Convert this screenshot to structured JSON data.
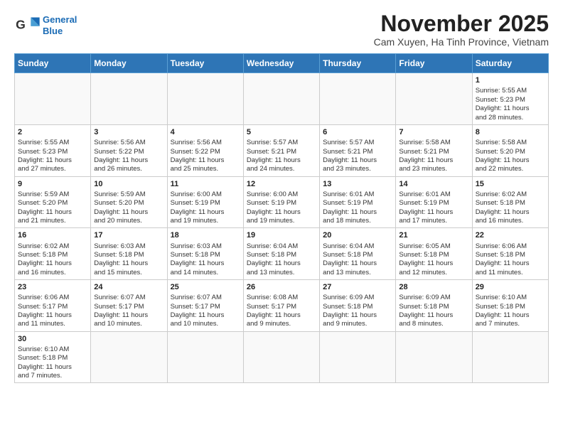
{
  "header": {
    "logo_line1": "General",
    "logo_line2": "Blue",
    "month": "November 2025",
    "location": "Cam Xuyen, Ha Tinh Province, Vietnam"
  },
  "weekdays": [
    "Sunday",
    "Monday",
    "Tuesday",
    "Wednesday",
    "Thursday",
    "Friday",
    "Saturday"
  ],
  "weeks": [
    [
      {
        "day": "",
        "info": ""
      },
      {
        "day": "",
        "info": ""
      },
      {
        "day": "",
        "info": ""
      },
      {
        "day": "",
        "info": ""
      },
      {
        "day": "",
        "info": ""
      },
      {
        "day": "",
        "info": ""
      },
      {
        "day": "1",
        "info": "Sunrise: 5:55 AM\nSunset: 5:23 PM\nDaylight: 11 hours\nand 28 minutes."
      }
    ],
    [
      {
        "day": "2",
        "info": "Sunrise: 5:55 AM\nSunset: 5:23 PM\nDaylight: 11 hours\nand 27 minutes."
      },
      {
        "day": "3",
        "info": "Sunrise: 5:56 AM\nSunset: 5:22 PM\nDaylight: 11 hours\nand 26 minutes."
      },
      {
        "day": "4",
        "info": "Sunrise: 5:56 AM\nSunset: 5:22 PM\nDaylight: 11 hours\nand 25 minutes."
      },
      {
        "day": "5",
        "info": "Sunrise: 5:57 AM\nSunset: 5:21 PM\nDaylight: 11 hours\nand 24 minutes."
      },
      {
        "day": "6",
        "info": "Sunrise: 5:57 AM\nSunset: 5:21 PM\nDaylight: 11 hours\nand 23 minutes."
      },
      {
        "day": "7",
        "info": "Sunrise: 5:58 AM\nSunset: 5:21 PM\nDaylight: 11 hours\nand 23 minutes."
      },
      {
        "day": "8",
        "info": "Sunrise: 5:58 AM\nSunset: 5:20 PM\nDaylight: 11 hours\nand 22 minutes."
      }
    ],
    [
      {
        "day": "9",
        "info": "Sunrise: 5:59 AM\nSunset: 5:20 PM\nDaylight: 11 hours\nand 21 minutes."
      },
      {
        "day": "10",
        "info": "Sunrise: 5:59 AM\nSunset: 5:20 PM\nDaylight: 11 hours\nand 20 minutes."
      },
      {
        "day": "11",
        "info": "Sunrise: 6:00 AM\nSunset: 5:19 PM\nDaylight: 11 hours\nand 19 minutes."
      },
      {
        "day": "12",
        "info": "Sunrise: 6:00 AM\nSunset: 5:19 PM\nDaylight: 11 hours\nand 19 minutes."
      },
      {
        "day": "13",
        "info": "Sunrise: 6:01 AM\nSunset: 5:19 PM\nDaylight: 11 hours\nand 18 minutes."
      },
      {
        "day": "14",
        "info": "Sunrise: 6:01 AM\nSunset: 5:19 PM\nDaylight: 11 hours\nand 17 minutes."
      },
      {
        "day": "15",
        "info": "Sunrise: 6:02 AM\nSunset: 5:18 PM\nDaylight: 11 hours\nand 16 minutes."
      }
    ],
    [
      {
        "day": "16",
        "info": "Sunrise: 6:02 AM\nSunset: 5:18 PM\nDaylight: 11 hours\nand 16 minutes."
      },
      {
        "day": "17",
        "info": "Sunrise: 6:03 AM\nSunset: 5:18 PM\nDaylight: 11 hours\nand 15 minutes."
      },
      {
        "day": "18",
        "info": "Sunrise: 6:03 AM\nSunset: 5:18 PM\nDaylight: 11 hours\nand 14 minutes."
      },
      {
        "day": "19",
        "info": "Sunrise: 6:04 AM\nSunset: 5:18 PM\nDaylight: 11 hours\nand 13 minutes."
      },
      {
        "day": "20",
        "info": "Sunrise: 6:04 AM\nSunset: 5:18 PM\nDaylight: 11 hours\nand 13 minutes."
      },
      {
        "day": "21",
        "info": "Sunrise: 6:05 AM\nSunset: 5:18 PM\nDaylight: 11 hours\nand 12 minutes."
      },
      {
        "day": "22",
        "info": "Sunrise: 6:06 AM\nSunset: 5:18 PM\nDaylight: 11 hours\nand 11 minutes."
      }
    ],
    [
      {
        "day": "23",
        "info": "Sunrise: 6:06 AM\nSunset: 5:17 PM\nDaylight: 11 hours\nand 11 minutes."
      },
      {
        "day": "24",
        "info": "Sunrise: 6:07 AM\nSunset: 5:17 PM\nDaylight: 11 hours\nand 10 minutes."
      },
      {
        "day": "25",
        "info": "Sunrise: 6:07 AM\nSunset: 5:17 PM\nDaylight: 11 hours\nand 10 minutes."
      },
      {
        "day": "26",
        "info": "Sunrise: 6:08 AM\nSunset: 5:17 PM\nDaylight: 11 hours\nand 9 minutes."
      },
      {
        "day": "27",
        "info": "Sunrise: 6:09 AM\nSunset: 5:18 PM\nDaylight: 11 hours\nand 9 minutes."
      },
      {
        "day": "28",
        "info": "Sunrise: 6:09 AM\nSunset: 5:18 PM\nDaylight: 11 hours\nand 8 minutes."
      },
      {
        "day": "29",
        "info": "Sunrise: 6:10 AM\nSunset: 5:18 PM\nDaylight: 11 hours\nand 7 minutes."
      }
    ],
    [
      {
        "day": "30",
        "info": "Sunrise: 6:10 AM\nSunset: 5:18 PM\nDaylight: 11 hours\nand 7 minutes."
      },
      {
        "day": "",
        "info": ""
      },
      {
        "day": "",
        "info": ""
      },
      {
        "day": "",
        "info": ""
      },
      {
        "day": "",
        "info": ""
      },
      {
        "day": "",
        "info": ""
      },
      {
        "day": "",
        "info": ""
      }
    ]
  ]
}
